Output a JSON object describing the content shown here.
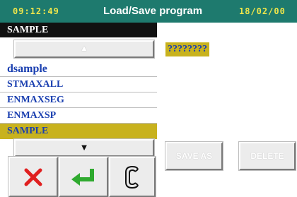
{
  "header": {
    "time": "09:12:49",
    "title": "Load/Save program",
    "date": "18/02/00"
  },
  "file_panel": {
    "current_file": "SAMPLE",
    "scroll_up_icon": "up-arrow-icon",
    "scroll_down_icon": "down-arrow-icon",
    "files": [
      {
        "name": "dsample"
      },
      {
        "name": "STMAXALL"
      },
      {
        "name": "ENMAXSEG"
      },
      {
        "name": "ENMAXSP"
      },
      {
        "name": "SAMPLE"
      }
    ],
    "selected_index": 4
  },
  "actions": {
    "cancel_icon": "close-x-icon",
    "confirm_icon": "enter-icon",
    "clear_icon": "clear-c-icon"
  },
  "program_panel": {
    "program_name": "????????",
    "save_as_label": "SAVE AS",
    "delete_label": "DELETE"
  },
  "colors": {
    "header_bg": "#1e7a6e",
    "header_accent": "#f0e64a",
    "selection": "#c8b21e",
    "list_text": "#1a3fb0",
    "cancel": "#e02020",
    "confirm": "#2faa2f"
  }
}
